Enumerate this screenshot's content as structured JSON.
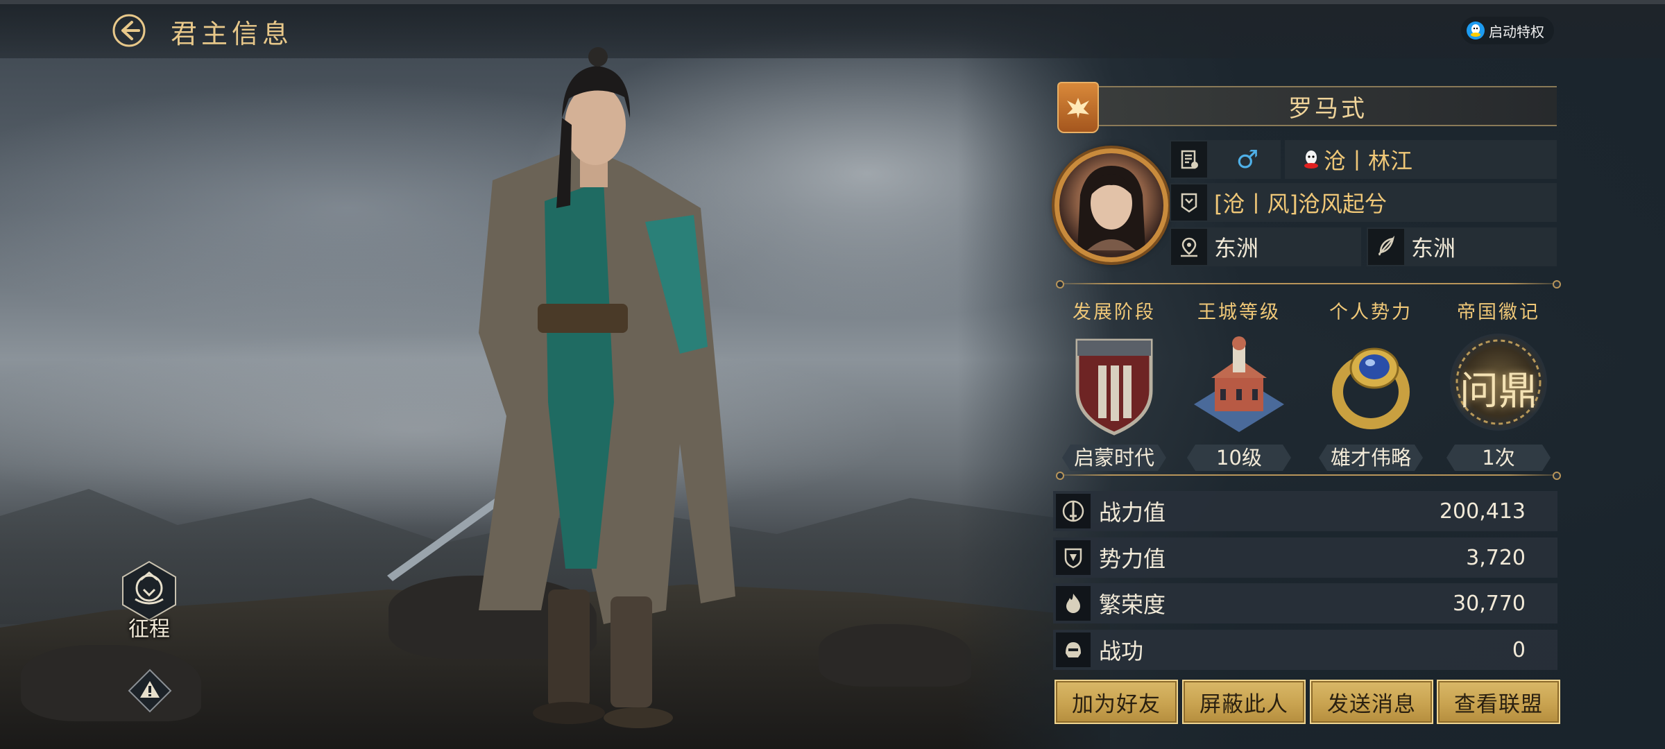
{
  "header": {
    "title": "君主信息",
    "privilege_label": "启动特权"
  },
  "left": {
    "expedition_label": "征程"
  },
  "profile": {
    "name": "罗马式",
    "gender_symbol": "♂",
    "server": "沧丨林江",
    "alliance": "[沧丨风]沧风起兮",
    "region": "东洲",
    "origin": "东洲"
  },
  "features": [
    {
      "title": "发展阶段",
      "value": "启蒙时代"
    },
    {
      "title": "王城等级",
      "value": "10级"
    },
    {
      "title": "个人势力",
      "value": "雄才伟略"
    },
    {
      "title": "帝国徽记",
      "value": "1次",
      "emblem_text": "问鼎"
    }
  ],
  "stats": [
    {
      "label": "战力值",
      "value": "200,413",
      "icon": "sword-icon"
    },
    {
      "label": "势力值",
      "value": "3,720",
      "icon": "shield-icon"
    },
    {
      "label": "繁荣度",
      "value": "30,770",
      "icon": "flame-icon"
    },
    {
      "label": "战功",
      "value": "0",
      "icon": "helmet-icon"
    }
  ],
  "actions": {
    "add_friend": "加为好友",
    "block": "屏蔽此人",
    "message": "发送消息",
    "view_alliance": "查看联盟"
  },
  "colors": {
    "gold": "#f0c878",
    "button_gold": "#c9a350",
    "panel": "#28303a"
  }
}
